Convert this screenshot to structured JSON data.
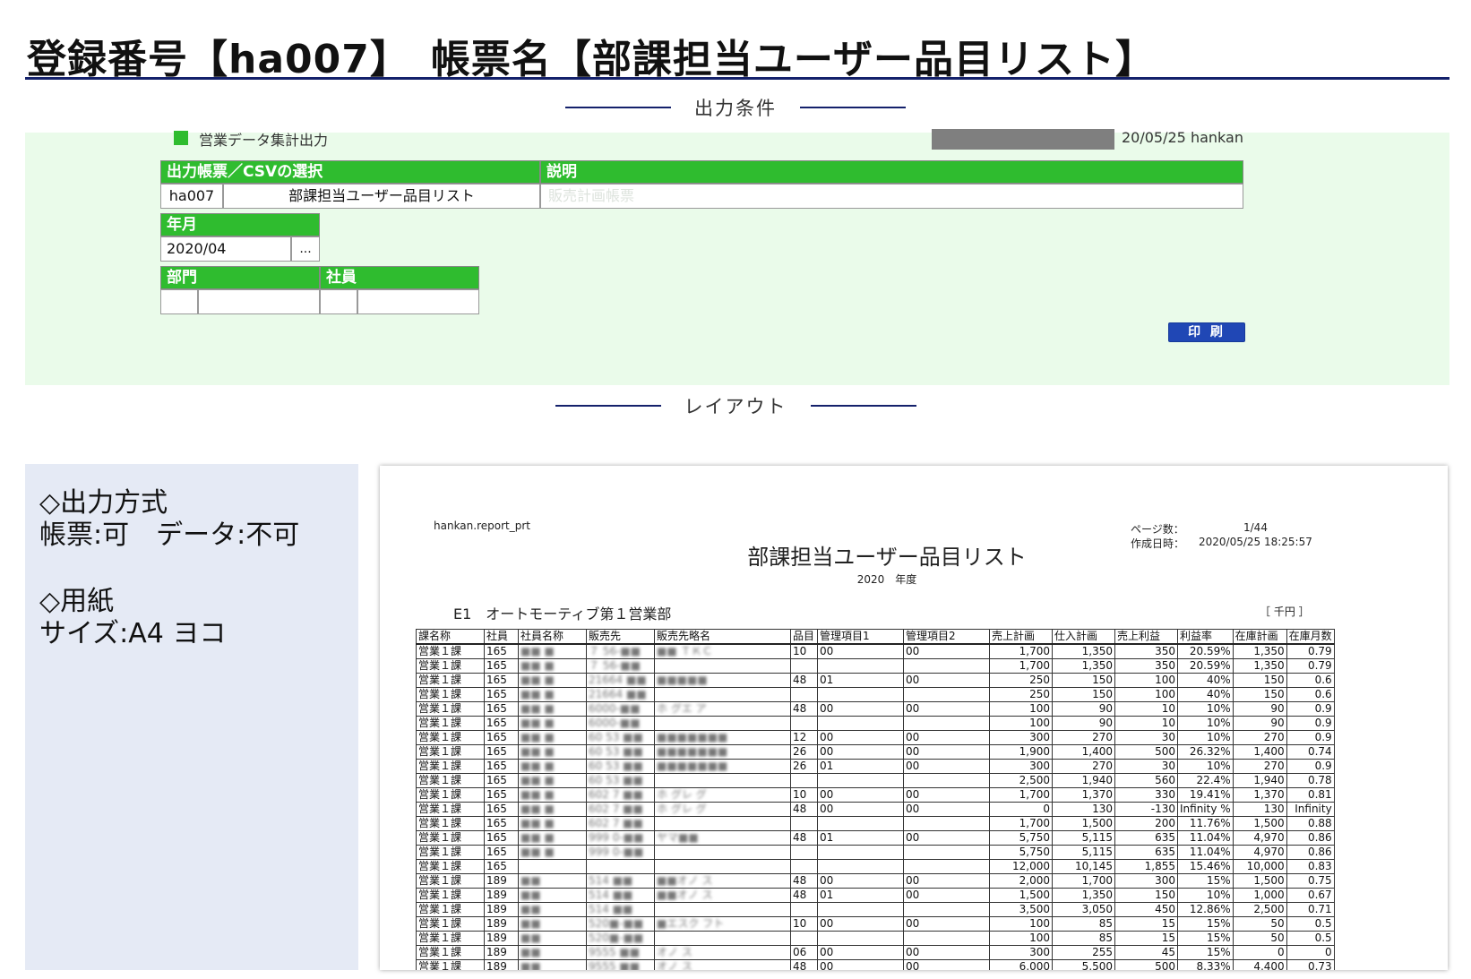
{
  "header": {
    "title": "登録番号【ha007】　帳票名【部課担当ユーザー品目リスト】"
  },
  "sections": {
    "conditions": "出力条件",
    "layout": "レイアウト"
  },
  "form": {
    "screen_name": "営業データ集計出力",
    "date_user": "20/05/25 hankan",
    "report_select_header": "出力帳票／CSVの選択",
    "description_header": "説明",
    "report_code": "ha007",
    "report_name": "部課担当ユーザー品目リスト",
    "description_value": "販売計画帳票",
    "yearmonth_header": "年月",
    "yearmonth_value": "2020/04",
    "yearmonth_button": "...",
    "department_header": "部門",
    "employee_header": "社員",
    "print_button": "印 刷"
  },
  "side": {
    "output_method_heading": "◇出力方式",
    "output_method_value": "帳票:可　データ:不可",
    "paper_heading": "◇用紙",
    "paper_value": "サイズ:A4 ヨコ"
  },
  "report": {
    "program": "hankan.report_prt",
    "page_label": "ページ数：",
    "page_value": "1/44",
    "created_label": "作成日時：",
    "created_value": "2020/05/25 18:25:57",
    "title": "部課担当ユーザー品目リスト",
    "fiscal_year": "2020　年度",
    "department": "E1　オートモーティブ第１営業部",
    "unit": "［ 千円 ］",
    "columns": [
      "課名称",
      "社員",
      "社員名称",
      "販売先",
      "販売先略名",
      "品目",
      "管理項目1",
      "管理項目2",
      "売上計画",
      "仕入計画",
      "売上利益",
      "利益率",
      "在庫計画",
      "在庫月数"
    ],
    "rows": [
      [
        "営業１課",
        "165",
        "■■ ■",
        "７ 56-■■",
        "■■ ＴＫＣ",
        "10",
        "00",
        "00",
        "1,700",
        "1,350",
        "350",
        "20.59%",
        "1,350",
        "0.79"
      ],
      [
        "営業１課",
        "165",
        "■■ ■",
        "７ 56-■■",
        "",
        "",
        "",
        "",
        "1,700",
        "1,350",
        "350",
        "20.59%",
        "1,350",
        "0.79"
      ],
      [
        "営業１課",
        "165",
        "■■ ■",
        "21664 ■■",
        "■■■■■",
        "48",
        "01",
        "00",
        "250",
        "150",
        "100",
        "40%",
        "150",
        "0.6"
      ],
      [
        "営業１課",
        "165",
        "■■ ■",
        "21664 ■■",
        "",
        "",
        "",
        "",
        "250",
        "150",
        "100",
        "40%",
        "150",
        "0.6"
      ],
      [
        "営業１課",
        "165",
        "■■ ■",
        "6000-■■",
        "ホ グエ ア",
        "48",
        "00",
        "00",
        "100",
        "90",
        "10",
        "10%",
        "90",
        "0.9"
      ],
      [
        "営業１課",
        "165",
        "■■ ■",
        "6000-■■",
        "",
        "",
        "",
        "",
        "100",
        "90",
        "10",
        "10%",
        "90",
        "0.9"
      ],
      [
        "営業１課",
        "165",
        "■■ ■",
        "60 53 ■■",
        "■■■■■■■",
        "12",
        "00",
        "00",
        "300",
        "270",
        "30",
        "10%",
        "270",
        "0.9"
      ],
      [
        "営業１課",
        "165",
        "■■ ■",
        "60 53 ■■",
        "■■■■■■■",
        "26",
        "00",
        "00",
        "1,900",
        "1,400",
        "500",
        "26.32%",
        "1,400",
        "0.74"
      ],
      [
        "営業１課",
        "165",
        "■■ ■",
        "60 53 ■■",
        "■■■■■■■",
        "26",
        "01",
        "00",
        "300",
        "270",
        "30",
        "10%",
        "270",
        "0.9"
      ],
      [
        "営業１課",
        "165",
        "■■ ■",
        "60 53 ■■",
        "",
        "",
        "",
        "",
        "2,500",
        "1,940",
        "560",
        "22.4%",
        "1,940",
        "0.78"
      ],
      [
        "営業１課",
        "165",
        "■■ ■",
        "602 7 ■■",
        "ホ グレ グ",
        "10",
        "00",
        "00",
        "1,700",
        "1,370",
        "330",
        "19.41%",
        "1,370",
        "0.81"
      ],
      [
        "営業１課",
        "165",
        "■■ ■",
        "602 7 ■■",
        "ホ グレ グ",
        "48",
        "00",
        "00",
        "0",
        "130",
        "-130",
        "Infinity %",
        "130",
        "Infinity"
      ],
      [
        "営業１課",
        "165",
        "■■ ■",
        "602 7 ■■",
        "",
        "",
        "",
        "",
        "1,700",
        "1,500",
        "200",
        "11.76%",
        "1,500",
        "0.88"
      ],
      [
        "営業１課",
        "165",
        "■■ ■",
        "999 0-■■",
        "ヤマ■■",
        "48",
        "01",
        "00",
        "5,750",
        "5,115",
        "635",
        "11.04%",
        "4,970",
        "0.86"
      ],
      [
        "営業１課",
        "165",
        "■■ ■",
        "999 0-■■",
        "",
        "",
        "",
        "",
        "5,750",
        "5,115",
        "635",
        "11.04%",
        "4,970",
        "0.86"
      ],
      [
        "営業１課",
        "165",
        "",
        "",
        "",
        "",
        "",
        "",
        "12,000",
        "10,145",
        "1,855",
        "15.46%",
        "10,000",
        "0.83"
      ],
      [
        "営業１課",
        "189",
        "■■",
        "514 ■■",
        "■■オノ ス",
        "48",
        "00",
        "00",
        "2,000",
        "1,700",
        "300",
        "15%",
        "1,500",
        "0.75"
      ],
      [
        "営業１課",
        "189",
        "■■",
        "514 ■■",
        "■■オノ ス",
        "48",
        "01",
        "00",
        "1,500",
        "1,350",
        "150",
        "10%",
        "1,000",
        "0.67"
      ],
      [
        "営業１課",
        "189",
        "■■",
        "514 ■■",
        "",
        "",
        "",
        "",
        "3,500",
        "3,050",
        "450",
        "12.86%",
        "2,500",
        "0.71"
      ],
      [
        "営業１課",
        "189",
        "■■",
        "520■-■■",
        "■エスク フト",
        "10",
        "00",
        "00",
        "100",
        "85",
        "15",
        "15%",
        "50",
        "0.5"
      ],
      [
        "営業１課",
        "189",
        "■■",
        "520■-■■",
        "",
        "",
        "",
        "",
        "100",
        "85",
        "15",
        "15%",
        "50",
        "0.5"
      ],
      [
        "営業１課",
        "189",
        "■■",
        "9555 ■■",
        "オノ ス",
        "06",
        "00",
        "00",
        "300",
        "255",
        "45",
        "15%",
        "0",
        "0"
      ],
      [
        "営業１課",
        "189",
        "■■",
        "9555 ■■",
        "オノ ス",
        "48",
        "00",
        "00",
        "6,000",
        "5,500",
        "500",
        "8.33%",
        "4,400",
        "0.73"
      ]
    ]
  },
  "colors": {
    "navy": "#14216b",
    "green": "#2fbc2f",
    "panel_green": "#eafbea",
    "panel_blue": "#e5eaf5",
    "button_blue": "#2047b5"
  }
}
